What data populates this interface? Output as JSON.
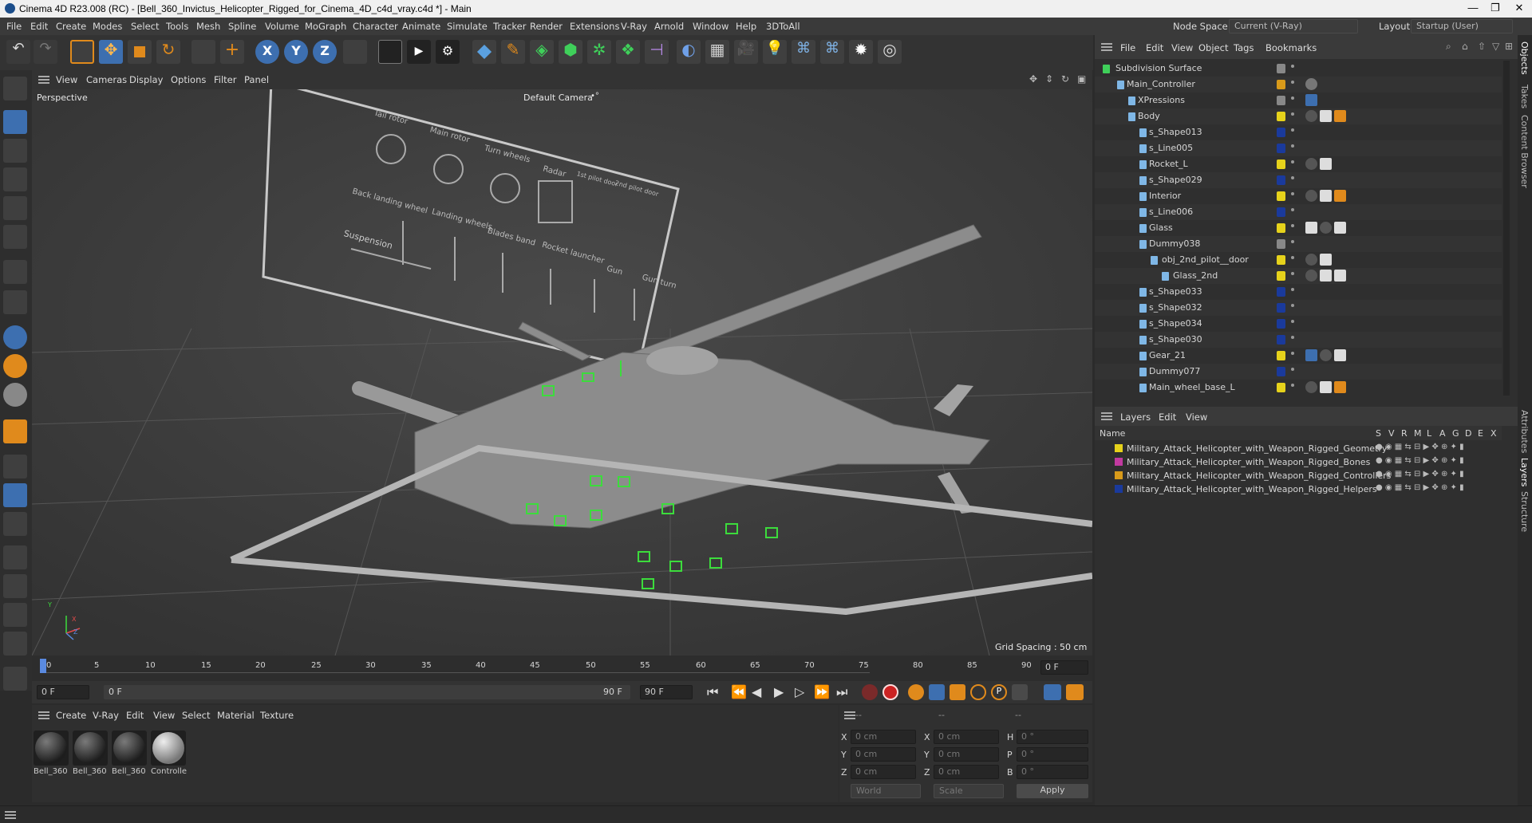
{
  "window": {
    "title": "Cinema 4D R23.008 (RC) - [Bell_360_Invictus_Helicopter_Rigged_for_Cinema_4D_c4d_vray.c4d *] - Main",
    "controls": [
      "—",
      "❐",
      "✕"
    ]
  },
  "menu": {
    "items": [
      "File",
      "Edit",
      "Create",
      "Modes",
      "Select",
      "Tools",
      "Mesh",
      "Spline",
      "Volume",
      "MoGraph",
      "Character",
      "Animate",
      "Simulate",
      "Tracker",
      "Render",
      "Extensions",
      "V-Ray",
      "Arnold",
      "Window",
      "Help",
      "3DToAll"
    ],
    "node_space_label": "Node Space:",
    "node_space_value": "Current (V-Ray)",
    "layout_label": "Layout:",
    "layout_value": "Startup (User)"
  },
  "viewport": {
    "menu": [
      "View",
      "Cameras",
      "Display",
      "Options",
      "Filter",
      "Panel"
    ],
    "label": "Perspective",
    "camera": "Default Camera",
    "camera_suffix": "•°",
    "grid_spacing": "Grid Spacing : 50 cm",
    "panel_labels": [
      "Tail rotor",
      "Main rotor",
      "Turn wheels",
      "Radar",
      "1st pilot door",
      "2nd pilot door",
      "Back landing wheel",
      "Landing wheels",
      "Blades band",
      "Rocket launcher",
      "Gun",
      "Gun turn",
      "Suspension"
    ],
    "axes": [
      "X",
      "Y",
      "Z"
    ]
  },
  "timeline": {
    "ticks": [
      "0",
      "5",
      "10",
      "15",
      "20",
      "25",
      "30",
      "35",
      "40",
      "45",
      "50",
      "55",
      "60",
      "65",
      "70",
      "75",
      "80",
      "85",
      "90"
    ],
    "current_frame": "0 F"
  },
  "transport": {
    "start_field": "0 F",
    "current_field": "0 F",
    "end_field_inner": "90 F",
    "end_field": "90 F"
  },
  "material_manager": {
    "menu": [
      "Create",
      "V-Ray",
      "Edit",
      "View",
      "Select",
      "Material",
      "Texture"
    ],
    "materials": [
      "Bell_360",
      "Bell_360",
      "Bell_360",
      "Controlle"
    ]
  },
  "coordinates": {
    "header": [
      "--",
      "--",
      "--"
    ],
    "rows": [
      {
        "a": "X",
        "av": "0 cm",
        "b": "X",
        "bv": "0 cm",
        "c": "H",
        "cv": "0 °"
      },
      {
        "a": "Y",
        "av": "0 cm",
        "b": "Y",
        "bv": "0 cm",
        "c": "P",
        "cv": "0 °"
      },
      {
        "a": "Z",
        "av": "0 cm",
        "b": "Z",
        "bv": "0 cm",
        "c": "B",
        "cv": "0 °"
      }
    ],
    "world": "World",
    "scale": "Scale",
    "apply": "Apply"
  },
  "object_manager": {
    "menu": [
      "File",
      "Edit",
      "View",
      "Object",
      "Tags",
      "Bookmarks"
    ],
    "objects": [
      {
        "name": "Subdivision Surface",
        "color": "#888888"
      },
      {
        "name": "Main_Controller",
        "color": "#d89a1a"
      },
      {
        "name": "XPressions",
        "color": "#888888"
      },
      {
        "name": "Body",
        "color": "#e6d21b"
      },
      {
        "name": "s_Shape013",
        "color": "#1a3a9c"
      },
      {
        "name": "s_Line005",
        "color": "#1a3a9c"
      },
      {
        "name": "Rocket_L",
        "color": "#e6d21b"
      },
      {
        "name": "s_Shape029",
        "color": "#1a3a9c"
      },
      {
        "name": "Interior",
        "color": "#e6d21b"
      },
      {
        "name": "s_Line006",
        "color": "#1a3a9c"
      },
      {
        "name": "Glass",
        "color": "#e6d21b"
      },
      {
        "name": "Dummy038",
        "color": "#888888"
      },
      {
        "name": "obj_2nd_pilot__door",
        "color": "#e6d21b"
      },
      {
        "name": "Glass_2nd",
        "color": "#e6d21b"
      },
      {
        "name": "s_Shape033",
        "color": "#1a3a9c"
      },
      {
        "name": "s_Shape032",
        "color": "#1a3a9c"
      },
      {
        "name": "s_Shape034",
        "color": "#1a3a9c"
      },
      {
        "name": "s_Shape030",
        "color": "#1a3a9c"
      },
      {
        "name": "Gear_21",
        "color": "#e6d21b"
      },
      {
        "name": "Dummy077",
        "color": "#1a3a9c"
      },
      {
        "name": "Main_wheel_base_L",
        "color": "#e6d21b"
      }
    ]
  },
  "layers": {
    "menu": [
      "Layers",
      "Edit",
      "View"
    ],
    "columns": [
      "Name",
      "S",
      "V",
      "R",
      "M",
      "L",
      "A",
      "G",
      "D",
      "E",
      "X"
    ],
    "items": [
      {
        "name": "Military_Attack_Helicopter_with_Weapon_Rigged_Geometry",
        "color": "#e6d21b"
      },
      {
        "name": "Military_Attack_Helicopter_with_Weapon_Rigged_Bones",
        "color": "#c23aa0"
      },
      {
        "name": "Military_Attack_Helicopter_with_Weapon_Rigged_Controllers",
        "color": "#d89a1a"
      },
      {
        "name": "Military_Attack_Helicopter_with_Weapon_Rigged_Helpers",
        "color": "#1a3a9c"
      }
    ]
  },
  "side_tabs": [
    "Objects",
    "Takes",
    "Content Browser",
    "Attributes",
    "Layers",
    "Structure"
  ]
}
